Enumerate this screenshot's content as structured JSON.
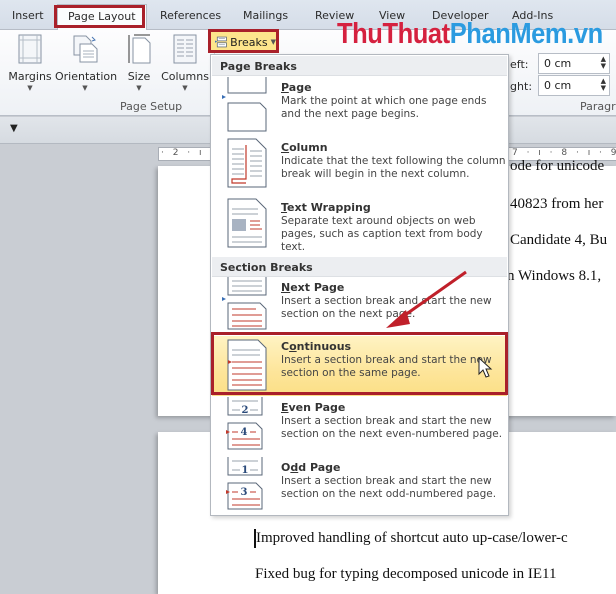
{
  "tabs": [
    {
      "label": "Insert"
    },
    {
      "label": "Page Layout",
      "active": true
    },
    {
      "label": "References"
    },
    {
      "label": "Mailings"
    },
    {
      "label": "Review"
    },
    {
      "label": "View"
    },
    {
      "label": "Developer"
    },
    {
      "label": "Add-Ins"
    }
  ],
  "ribbon": {
    "page_setup": {
      "buttons": [
        {
          "label": "Margins",
          "icon": "margins-icon"
        },
        {
          "label": "Orientation",
          "icon": "orientation-icon"
        },
        {
          "label": "Size",
          "icon": "size-icon"
        },
        {
          "label": "Columns",
          "icon": "columns-icon"
        }
      ],
      "breaks_label": "Breaks",
      "group_label": "Page Setup"
    },
    "paragraph": {
      "left_label": "eft:",
      "left_value": "0 cm",
      "right_label": "ight:",
      "right_value": "0 cm",
      "group_label": "Paragr"
    }
  },
  "watermark": {
    "part1": "ThuThuat",
    "part2": "PhanMem",
    "part3": ".vn"
  },
  "ruler": {
    "left": "· 2 · ı ·",
    "right": "7 · ı · 8 · ı · 9 · ı"
  },
  "menu": {
    "page_breaks_header": "Page Breaks",
    "section_breaks_header": "Section Breaks",
    "items": [
      {
        "key": "P",
        "rest": "age",
        "title": "Page",
        "desc": "Mark the point at which one page ends and the next page begins."
      },
      {
        "key": "C",
        "rest": "olumn",
        "title": "Column",
        "desc": "Indicate that the text following the column break will begin in the next column."
      },
      {
        "key": "T",
        "rest": "ext Wrapping",
        "title": "Text Wrapping",
        "desc": "Separate text around objects on web pages, such as caption text from body text."
      },
      {
        "key": "N",
        "rest": "ext Page",
        "title": "Next Page",
        "desc": "Insert a section break and start the new section on the next page."
      },
      {
        "pre": "C",
        "key": "o",
        "rest": "ntinuous",
        "title": "Continuous",
        "desc": "Insert a section break and start the new section on the same page.",
        "highlighted": true
      },
      {
        "key": "E",
        "rest": "ven Page",
        "title": "Even Page",
        "desc": "Insert a section break and start the new section on the next even-numbered page."
      },
      {
        "pre": "O",
        "key": "d",
        "rest": "d Page",
        "title": "Odd Page",
        "desc": "Insert a section break and start the new section on the next odd-numbered page."
      }
    ]
  },
  "document": {
    "page1_lines": [
      "ode for unicode",
      "40823 from her",
      "Candidate 4, Bu",
      "n Windows 8.1,"
    ],
    "page2_lines": [
      "Improved handling of shortcut auto up-case/lower-c",
      "Fixed bug for typing decomposed unicode in IE11"
    ]
  },
  "colors": {
    "highlight": "#a9202a",
    "hover": "#fde59a"
  }
}
